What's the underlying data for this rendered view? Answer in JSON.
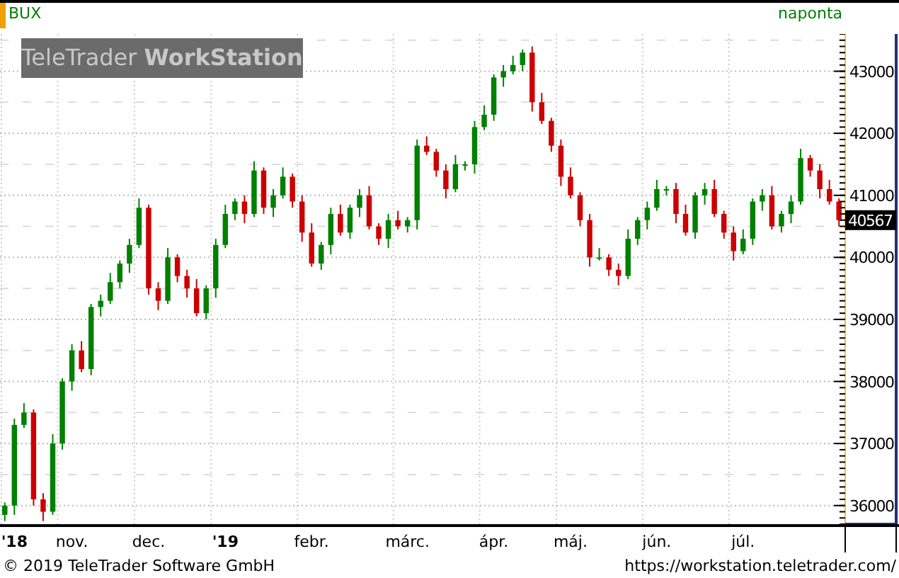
{
  "header": {
    "symbol": "BUX",
    "interval": "naponta"
  },
  "logo": "TeleTrader **WorkStation**",
  "chart": {
    "last_price": "40567",
    "year_labels": [
      true,
      false,
      false,
      true,
      false,
      false,
      false,
      false,
      false,
      false
    ],
    "chart_data": {
      "type": "candlestick",
      "grid": true,
      "ylim": [
        35700,
        43600
      ],
      "yticks": [
        36000,
        37000,
        38000,
        39000,
        40000,
        41000,
        42000,
        43000
      ],
      "categories": [
        null,
        "'18",
        null,
        null,
        null,
        null,
        null,
        "nov.",
        null,
        null,
        null,
        null,
        null,
        null,
        null,
        "dec.",
        null,
        null,
        null,
        null,
        null,
        null,
        null,
        "'19",
        null,
        null,
        null,
        null,
        null,
        null,
        null,
        null,
        "febr.",
        null,
        null,
        null,
        null,
        null,
        null,
        null,
        null,
        null,
        "márc.",
        null,
        null,
        null,
        null,
        null,
        null,
        null,
        null,
        "ápr.",
        null,
        null,
        null,
        null,
        null,
        null,
        null,
        "máj.",
        null,
        null,
        null,
        null,
        null,
        null,
        null,
        null,
        "jún.",
        null,
        null,
        null,
        null,
        null,
        null,
        null,
        null,
        "júl.",
        null,
        null,
        null,
        null,
        null,
        null,
        null,
        null,
        null,
        null
      ],
      "ohlc": [
        [
          35850,
          36050,
          35750,
          36000
        ],
        [
          36000,
          37400,
          35850,
          37300
        ],
        [
          37300,
          37650,
          37250,
          37500
        ],
        [
          37500,
          37550,
          36000,
          36100
        ],
        [
          36100,
          36200,
          35750,
          35900
        ],
        [
          35900,
          37150,
          35850,
          37000
        ],
        [
          37000,
          38050,
          36900,
          38000
        ],
        [
          38000,
          38600,
          37850,
          38500
        ],
        [
          38500,
          38650,
          38150,
          38200
        ],
        [
          38200,
          39250,
          38100,
          39200
        ],
        [
          39200,
          39400,
          39050,
          39300
        ],
        [
          39300,
          39750,
          39250,
          39600
        ],
        [
          39600,
          39950,
          39500,
          39900
        ],
        [
          39900,
          40300,
          39750,
          40200
        ],
        [
          40200,
          40950,
          40150,
          40800
        ],
        [
          40800,
          40850,
          39400,
          39500
        ],
        [
          39500,
          39600,
          39150,
          39300
        ],
        [
          39300,
          40150,
          39250,
          40000
        ],
        [
          40000,
          40050,
          39600,
          39700
        ],
        [
          39700,
          39800,
          39350,
          39500
        ],
        [
          39500,
          39650,
          39050,
          39100
        ],
        [
          39100,
          39550,
          39000,
          39500
        ],
        [
          39500,
          40300,
          39350,
          40200
        ],
        [
          40200,
          40850,
          40150,
          40700
        ],
        [
          40700,
          40950,
          40600,
          40900
        ],
        [
          40900,
          41000,
          40550,
          40700
        ],
        [
          40700,
          41550,
          40650,
          41400
        ],
        [
          41400,
          41450,
          40700,
          40800
        ],
        [
          40800,
          41100,
          40650,
          41000
        ],
        [
          41000,
          41450,
          40950,
          41300
        ],
        [
          41300,
          41350,
          40800,
          40900
        ],
        [
          40900,
          41000,
          40250,
          40400
        ],
        [
          40400,
          40550,
          39850,
          39900
        ],
        [
          39900,
          40250,
          39800,
          40200
        ],
        [
          40200,
          40800,
          40050,
          40700
        ],
        [
          40700,
          40850,
          40350,
          40400
        ],
        [
          40400,
          40850,
          40300,
          40800
        ],
        [
          40800,
          41100,
          40650,
          41000
        ],
        [
          41000,
          41150,
          40450,
          40500
        ],
        [
          40500,
          40550,
          40200,
          40300
        ],
        [
          40300,
          40700,
          40150,
          40600
        ],
        [
          40600,
          40750,
          40450,
          40500
        ],
        [
          40500,
          40650,
          40400,
          40600
        ],
        [
          40600,
          41900,
          40450,
          41800
        ],
        [
          41800,
          41950,
          41650,
          41700
        ],
        [
          41700,
          41750,
          41300,
          41400
        ],
        [
          41400,
          41500,
          40950,
          41100
        ],
        [
          41100,
          41650,
          41050,
          41500
        ],
        [
          41500,
          41550,
          41400,
          41500
        ],
        [
          41500,
          42200,
          41350,
          42100
        ],
        [
          42100,
          42450,
          42050,
          42300
        ],
        [
          42300,
          42950,
          42200,
          42900
        ],
        [
          42900,
          43100,
          42750,
          43000
        ],
        [
          43000,
          43250,
          42950,
          43100
        ],
        [
          43100,
          43350,
          43000,
          43300
        ],
        [
          43300,
          43400,
          42350,
          42500
        ],
        [
          42500,
          42650,
          42150,
          42200
        ],
        [
          42200,
          42250,
          41700,
          41800
        ],
        [
          41800,
          41900,
          41150,
          41300
        ],
        [
          41300,
          41450,
          40950,
          41000
        ],
        [
          41000,
          41050,
          40500,
          40600
        ],
        [
          40600,
          40700,
          39850,
          40000
        ],
        [
          40000,
          40150,
          39950,
          40000
        ],
        [
          40000,
          40050,
          39700,
          39800
        ],
        [
          39800,
          39900,
          39550,
          39700
        ],
        [
          39700,
          40450,
          39650,
          40300
        ],
        [
          40300,
          40650,
          40200,
          40600
        ],
        [
          40600,
          40900,
          40450,
          40800
        ],
        [
          40800,
          41250,
          40750,
          41100
        ],
        [
          41100,
          41150,
          41000,
          41100
        ],
        [
          41100,
          41200,
          40550,
          40700
        ],
        [
          40700,
          40850,
          40350,
          40400
        ],
        [
          40400,
          41050,
          40300,
          41000
        ],
        [
          41000,
          41200,
          40850,
          41100
        ],
        [
          41100,
          41250,
          40650,
          40700
        ],
        [
          40700,
          40750,
          40300,
          40400
        ],
        [
          40400,
          40500,
          39950,
          40100
        ],
        [
          40100,
          40450,
          40050,
          40300
        ],
        [
          40300,
          40950,
          40200,
          40900
        ],
        [
          40900,
          41100,
          40750,
          41000
        ],
        [
          41000,
          41150,
          40450,
          40500
        ],
        [
          40500,
          40750,
          40400,
          40700
        ],
        [
          40700,
          41000,
          40550,
          40900
        ],
        [
          40900,
          41750,
          40850,
          41600
        ],
        [
          41600,
          41650,
          41300,
          41400
        ],
        [
          41400,
          41500,
          40950,
          41100
        ],
        [
          41100,
          41250,
          40850,
          40900
        ],
        [
          40900,
          40950,
          40500,
          40600
        ]
      ]
    }
  },
  "footer": {
    "copyright": "© 2019 TeleTrader Software GmbH",
    "url": "https://workstation.teletrader.com/"
  }
}
